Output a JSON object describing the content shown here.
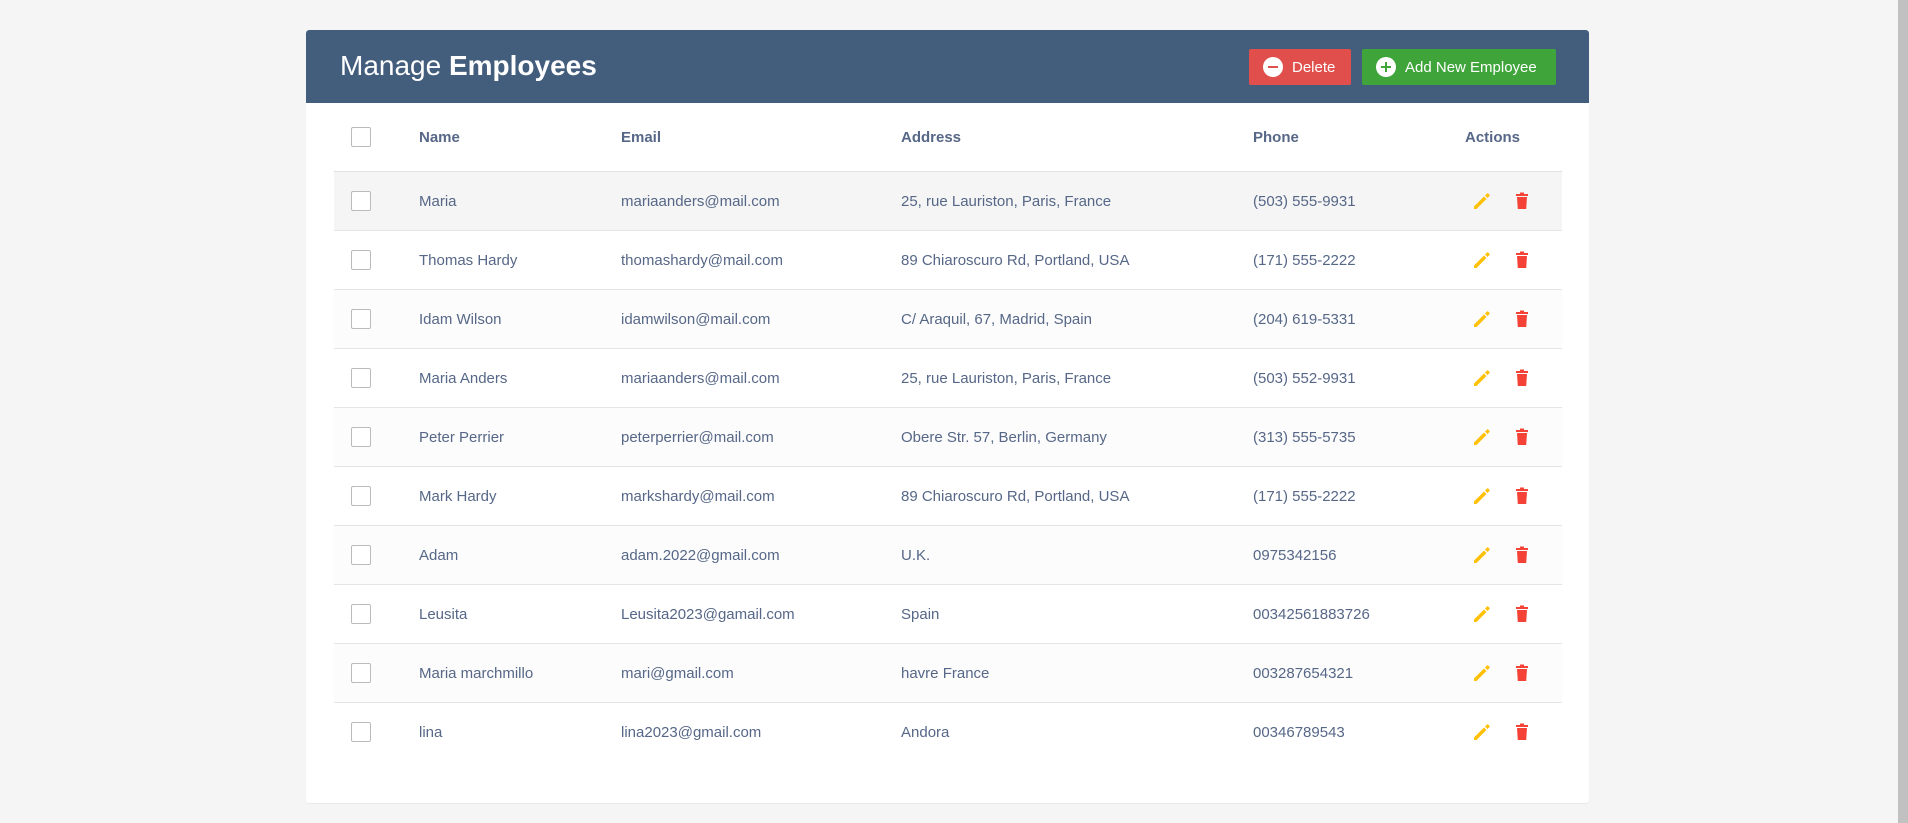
{
  "header": {
    "title_light": "Manage",
    "title_bold": "Employees",
    "delete_label": "Delete",
    "add_label": "Add New Employee"
  },
  "colors": {
    "header_bg": "#435d7d",
    "delete_btn": "#e04f4b",
    "add_btn": "#3fa53a",
    "edit_icon": "#ffc107",
    "delete_icon": "#f44336"
  },
  "icons": {
    "delete_button": "minus-circle-icon",
    "add_button": "plus-circle-icon",
    "row_edit": "pencil-icon",
    "row_delete": "trash-icon"
  },
  "table": {
    "columns": [
      "Name",
      "Email",
      "Address",
      "Phone",
      "Actions"
    ],
    "rows": [
      {
        "name": "Maria",
        "email": "mariaanders@mail.com",
        "address": "25, rue Lauriston, Paris, France",
        "phone": "(503) 555-9931"
      },
      {
        "name": "Thomas Hardy",
        "email": "thomashardy@mail.com",
        "address": "89 Chiaroscuro Rd, Portland, USA",
        "phone": "(171) 555-2222"
      },
      {
        "name": "Idam Wilson",
        "email": "idamwilson@mail.com",
        "address": "C/ Araquil, 67, Madrid, Spain",
        "phone": "(204) 619-5331"
      },
      {
        "name": "Maria Anders",
        "email": "mariaanders@mail.com",
        "address": "25, rue Lauriston, Paris, France",
        "phone": "(503) 552-9931"
      },
      {
        "name": "Peter Perrier",
        "email": "peterperrier@mail.com",
        "address": "Obere Str. 57, Berlin, Germany",
        "phone": "(313) 555-5735"
      },
      {
        "name": "Mark Hardy",
        "email": "markshardy@mail.com",
        "address": "89 Chiaroscuro Rd, Portland, USA",
        "phone": "(171) 555-2222"
      },
      {
        "name": "Adam",
        "email": "adam.2022@gmail.com",
        "address": "U.K.",
        "phone": "0975342156"
      },
      {
        "name": "Leusita",
        "email": "Leusita2023@gamail.com",
        "address": "Spain",
        "phone": "00342561883726"
      },
      {
        "name": "Maria marchmillo",
        "email": "mari@gmail.com",
        "address": "havre France",
        "phone": "003287654321"
      },
      {
        "name": "lina",
        "email": "lina2023@gmail.com",
        "address": "Andora",
        "phone": "00346789543"
      }
    ]
  }
}
